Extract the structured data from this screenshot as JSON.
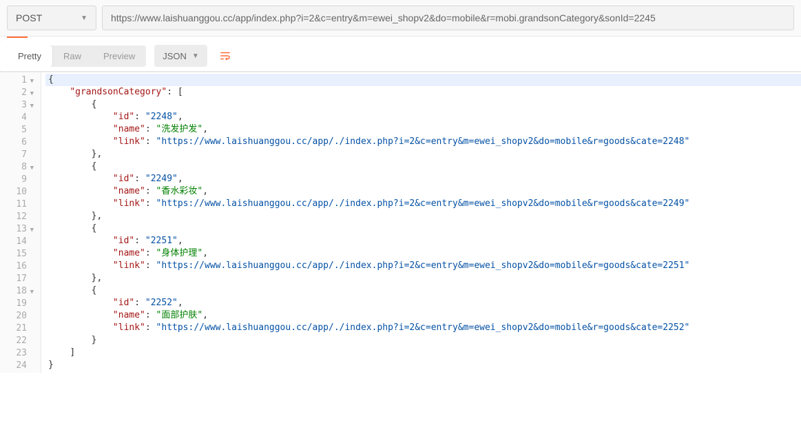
{
  "method": "POST",
  "url": "https://www.laishuanggou.cc/app/index.php?i=2&c=entry&m=ewei_shopv2&do=mobile&r=mobi.grandsonCategory&sonId=2245",
  "view_tabs": {
    "pretty": "Pretty",
    "raw": "Raw",
    "preview": "Preview"
  },
  "format": "JSON",
  "json": {
    "root_key": "grandsonCategory",
    "items": [
      {
        "id": "2248",
        "name": "洗发护发",
        "link": "https://www.laishuanggou.cc/app/./index.php?i=2&c=entry&m=ewei_shopv2&do=mobile&r=goods&cate=2248"
      },
      {
        "id": "2249",
        "name": "香水彩妆",
        "link": "https://www.laishuanggou.cc/app/./index.php?i=2&c=entry&m=ewei_shopv2&do=mobile&r=goods&cate=2249"
      },
      {
        "id": "2251",
        "name": "身体护理",
        "link": "https://www.laishuanggou.cc/app/./index.php?i=2&c=entry&m=ewei_shopv2&do=mobile&r=goods&cate=2251"
      },
      {
        "id": "2252",
        "name": "面部护肤",
        "link": "https://www.laishuanggou.cc/app/./index.php?i=2&c=entry&m=ewei_shopv2&do=mobile&r=goods&cate=2252"
      }
    ]
  },
  "labels": {
    "id": "id",
    "name": "name",
    "link": "link"
  }
}
